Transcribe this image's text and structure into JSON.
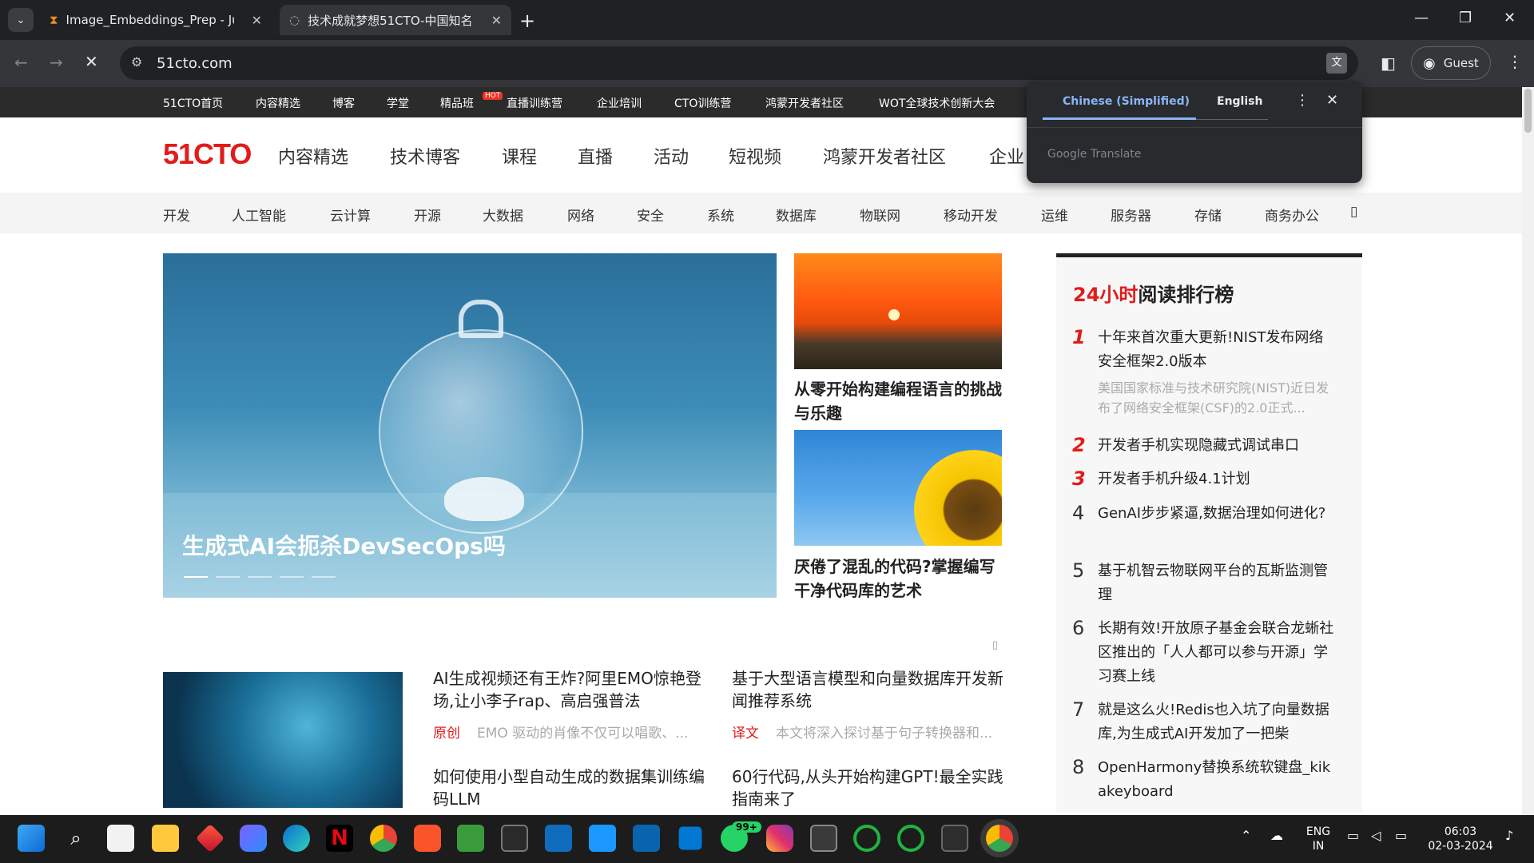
{
  "browser": {
    "tabs": [
      {
        "title": "Image_Embeddings_Prep - Jupy",
        "icon": "hourglass-icon"
      },
      {
        "title": "技术成就梦想51CTO-中国知名",
        "icon": "loading-icon"
      }
    ],
    "url": "51cto.com",
    "profile": "Guest"
  },
  "translate_popup": {
    "lang_from": "Chinese (Simplified)",
    "lang_to": "English",
    "brand": "Google Translate"
  },
  "topnav": {
    "items": [
      "51CTO首页",
      "内容精选",
      "博客",
      "学堂",
      "精品班",
      "直播训练营",
      "企业培训",
      "CTO训练营",
      "鸿蒙开发者社区",
      "WOT全球技术创新大会"
    ],
    "hot_badge": "HOT"
  },
  "site": {
    "logo": "51CTO",
    "main_nav": [
      "内容精选",
      "技术博客",
      "课程",
      "直播",
      "活动",
      "短视频",
      "鸿蒙开发者社区",
      "企业"
    ],
    "categories": [
      "开发",
      "人工智能",
      "云计算",
      "开源",
      "大数据",
      "网络",
      "安全",
      "系统",
      "数据库",
      "物联网",
      "移动开发",
      "运维",
      "服务器",
      "存储",
      "商务办公"
    ]
  },
  "hero": {
    "title": "生成式AI会扼杀DevSecOps吗"
  },
  "side_articles": [
    {
      "title": "从零开始构建编程语言的挑战与乐趣"
    },
    {
      "title": "厌倦了混乱的代码?掌握编写干净代码库的艺术"
    }
  ],
  "ranking": {
    "title_red": "24小时",
    "title_rest": "阅读排行榜",
    "items": [
      {
        "num": "1",
        "title": "十年来首次重大更新!NIST发布网络安全框架2.0版本",
        "desc": "美国国家标准与技术研究院(NIST)近日发布了网络安全框架(CSF)的2.0正式..."
      },
      {
        "num": "2",
        "title": "开发者手机实现隐藏式调试串口"
      },
      {
        "num": "3",
        "title": "开发者手机升级4.1计划"
      },
      {
        "num": "4",
        "title": "GenAI步步紧逼,数据治理如何进化?"
      },
      {
        "num": "5",
        "title": "基于机智云物联网平台的瓦斯监测管理"
      },
      {
        "num": "6",
        "title": "长期有效!开放原子基金会联合龙蜥社区推出的「人人都可以参与开源」学习赛上线"
      },
      {
        "num": "7",
        "title": "就是这么火!Redis也入坑了向量数据库,为生成式AI开发加了一把柴"
      },
      {
        "num": "8",
        "title": "OpenHarmony替换系统软键盘_kikakeyboard"
      }
    ]
  },
  "articles": [
    {
      "title": "AI生成视频还有王炸?阿里EMO惊艳登场,让小李子rap、高启强普法",
      "tag": "原创",
      "desc": "EMO 驱动的肖像不仅可以唱歌、..."
    },
    {
      "title": "基于大型语言模型和向量数据库开发新闻推荐系统",
      "tag": "译文",
      "desc": "本文将深入探讨基于句子转换器和..."
    },
    {
      "title": "如何使用小型自动生成的数据集训练编码LLM"
    },
    {
      "title": "60行代码,从头开始构建GPT!最全实践指南来了"
    }
  ],
  "taskbar": {
    "lang": "ENG",
    "region": "IN",
    "time": "06:03",
    "date": "02-03-2024",
    "badge": "99+"
  }
}
